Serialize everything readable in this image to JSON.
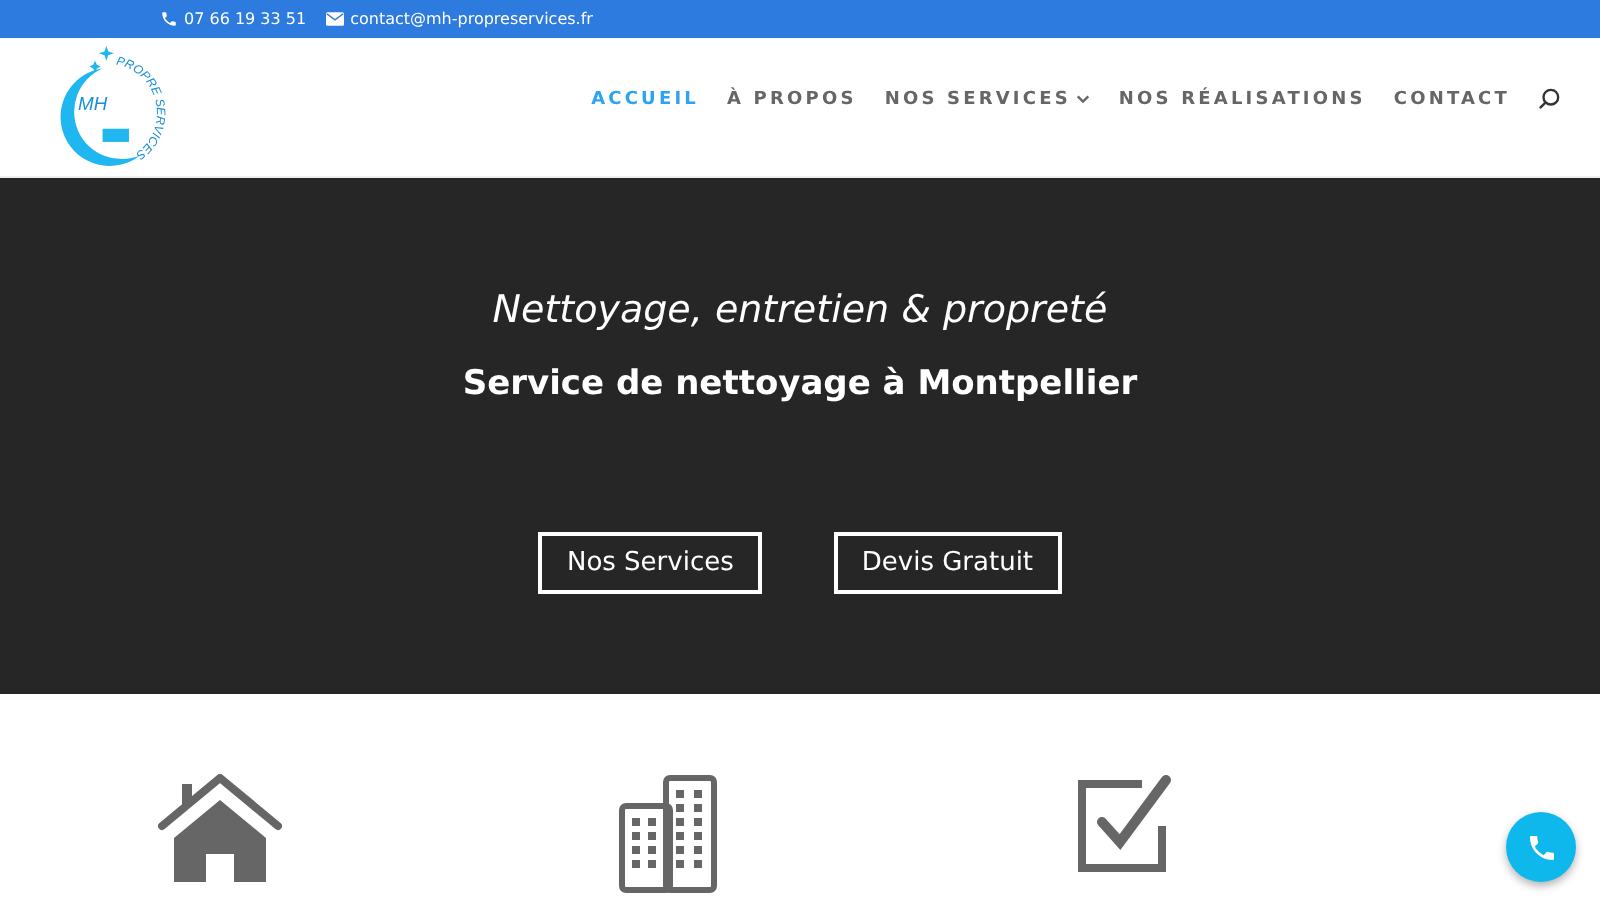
{
  "top_bar": {
    "phone": "07 66 19 33 51",
    "email": "contact@mh-propreservices.fr"
  },
  "logo": {
    "initials": "MH",
    "tagline": "PROPRE SERVICES"
  },
  "nav": [
    {
      "label": "ACCUEIL",
      "selected": true,
      "dropdown": false
    },
    {
      "label": "À PROPOS",
      "selected": false,
      "dropdown": false
    },
    {
      "label": "NOS SERVICES",
      "selected": false,
      "dropdown": true
    },
    {
      "label": "NOS RÉALISATIONS",
      "selected": false,
      "dropdown": false
    },
    {
      "label": "CONTACT",
      "selected": false,
      "dropdown": false
    }
  ],
  "hero": {
    "subtitle": "Nettoyage, entretien & propreté",
    "title": "Service de nettoyage à Montpellier",
    "buttons": [
      "Nos Services",
      "Devis Gratuit"
    ]
  },
  "features": [
    {
      "kind": "house"
    },
    {
      "kind": "buildings"
    },
    {
      "kind": "checkbox"
    }
  ]
}
